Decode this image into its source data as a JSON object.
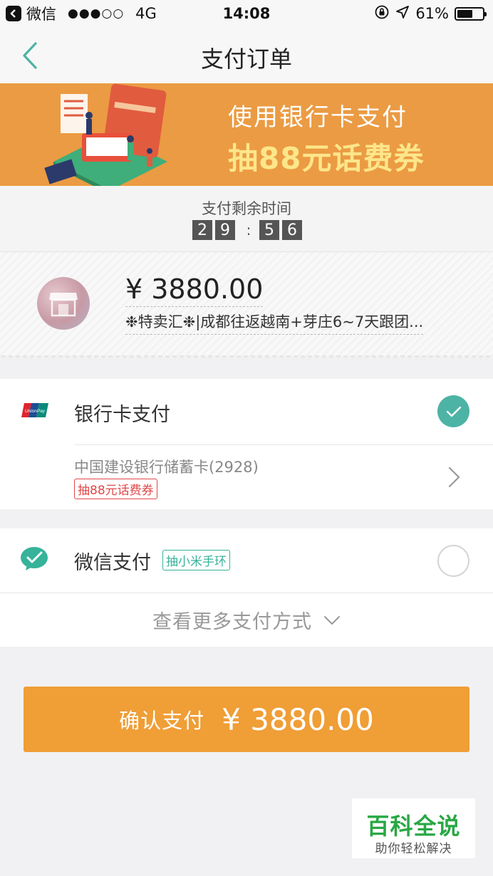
{
  "status_bar": {
    "carrier": "微信",
    "signal": "●●●○○",
    "network": "4G",
    "time": "14:08",
    "battery_percent": "61%",
    "battery_level": 0.61
  },
  "nav": {
    "title": "支付订单",
    "back_icon": "chevron-left-icon",
    "accent_color": "#4db3a4"
  },
  "banner": {
    "line1": "使用银行卡支付",
    "line2": "抽88元话费券",
    "background": "#eb9b43"
  },
  "countdown": {
    "label": "支付剩余时间",
    "minutes": [
      "2",
      "9"
    ],
    "separator": ":",
    "seconds": [
      "5",
      "6"
    ]
  },
  "order": {
    "amount": "¥ 3880.00",
    "description": "❉特卖汇❉|成都往返越南+芽庄6~7天跟团..."
  },
  "payment": {
    "bank": {
      "label": "银行卡支付",
      "selected": true,
      "card_name": "中国建设银行储蓄卡(2928)",
      "promo": "抽88元话费券",
      "icon": "unionpay-icon"
    },
    "wechat": {
      "label": "微信支付",
      "promo": "抽小米手环",
      "selected": false,
      "icon": "wechat-pay-icon"
    },
    "more_label": "查看更多支付方式"
  },
  "confirm": {
    "label": "确认支付",
    "amount": "¥ 3880.00",
    "color": "#f09e36"
  },
  "watermark": {
    "title": "百科全说",
    "subtitle": "助你轻松解决"
  }
}
